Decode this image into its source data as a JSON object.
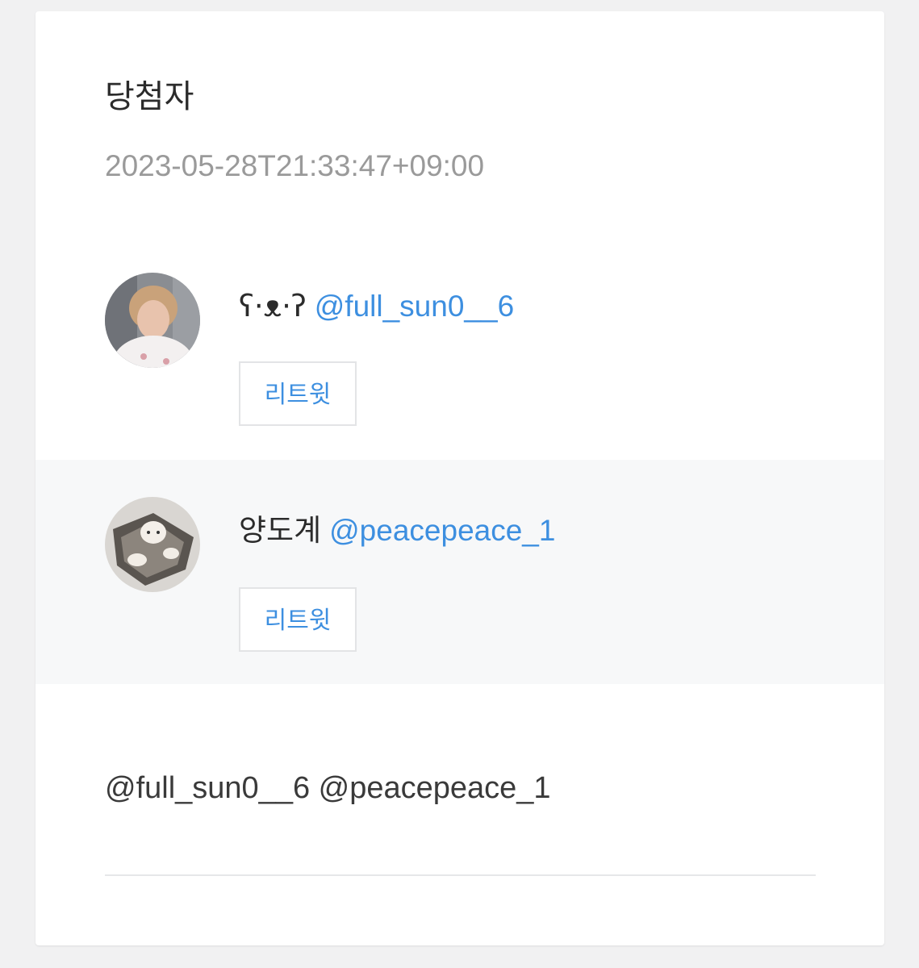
{
  "card": {
    "title": "당첨자",
    "timestamp": "2023-05-28T21:33:47+09:00"
  },
  "winners": [
    {
      "display_name": "ʕ·ᴥ·ʔ",
      "handle": "@full_sun0__6",
      "button_label": "리트윗",
      "avatar_icon": "profile-photo-person"
    },
    {
      "display_name": "양도계",
      "handle": "@peacepeace_1",
      "button_label": "리트윗",
      "avatar_icon": "profile-photo-plush-doll"
    }
  ],
  "mentions_text": "@full_sun0__6 @peacepeace_1",
  "colors": {
    "page_background": "#f1f1f2",
    "card_background": "#ffffff",
    "alt_row_background": "#f7f8f9",
    "link_blue": "#3d8fe0",
    "muted_text": "#9a9a9a"
  }
}
